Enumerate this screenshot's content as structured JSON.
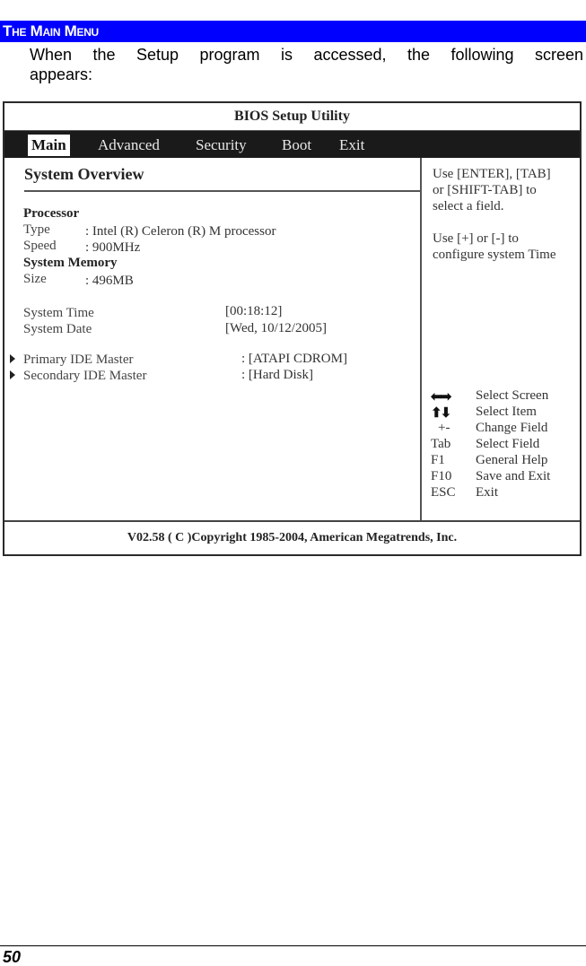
{
  "section": {
    "title": "The Main Menu"
  },
  "intro": {
    "line1": "When the Setup program is accessed, the following screen",
    "line2": "appears:"
  },
  "bios": {
    "title": "BIOS Setup Utility",
    "tabs": [
      {
        "label": "Main",
        "active": true
      },
      {
        "label": "Advanced",
        "active": false
      },
      {
        "label": "Security",
        "active": false
      },
      {
        "label": "Boot",
        "active": false
      },
      {
        "label": "Exit",
        "active": false
      }
    ],
    "overview_title": "System Overview",
    "processor": {
      "heading": "Processor",
      "type_label": "Type",
      "type_value": ": Intel (R)  Celeron (R)  M processor",
      "speed_label": "Speed",
      "speed_value": ": 900MHz"
    },
    "memory": {
      "heading": "System Memory",
      "size_label": "Size",
      "size_value": ": 496MB"
    },
    "system_time": {
      "label": "System Time",
      "value": "[00:18:12]"
    },
    "system_date": {
      "label": "System Date",
      "value": "[Wed, 10/12/2005]"
    },
    "ide": [
      {
        "label": "Primary IDE Master",
        "value": ": [ATAPI CDROM]",
        "icon": "submenu-arrow-icon"
      },
      {
        "label": "Secondary IDE Master",
        "value": ": [Hard Disk]",
        "icon": "submenu-arrow-icon"
      }
    ],
    "help": {
      "lines_1": [
        "Use [ENTER], [TAB]",
        "or [SHIFT-TAB] to",
        "select a field."
      ],
      "lines_2": [
        "Use [+] or [-] to",
        "configure system Time"
      ]
    },
    "keys": [
      {
        "key": "⬅➡",
        "icon": "left-right-arrows-icon",
        "desc": "Select Screen"
      },
      {
        "key": "⬆⬇",
        "icon": "up-down-arrows-icon",
        "desc": "Select Item"
      },
      {
        "key": "+-",
        "icon": "plus-minus-icon",
        "desc": "Change Field"
      },
      {
        "key": "Tab",
        "desc": "Select Field"
      },
      {
        "key": "F1",
        "desc": "General Help"
      },
      {
        "key": "F10",
        "desc": "Save and Exit"
      },
      {
        "key": "ESC",
        "desc": "Exit"
      }
    ],
    "footer": "V02.58 ( C )Copyright 1985-2004, American Megatrends, Inc."
  },
  "page": {
    "number": "50"
  }
}
